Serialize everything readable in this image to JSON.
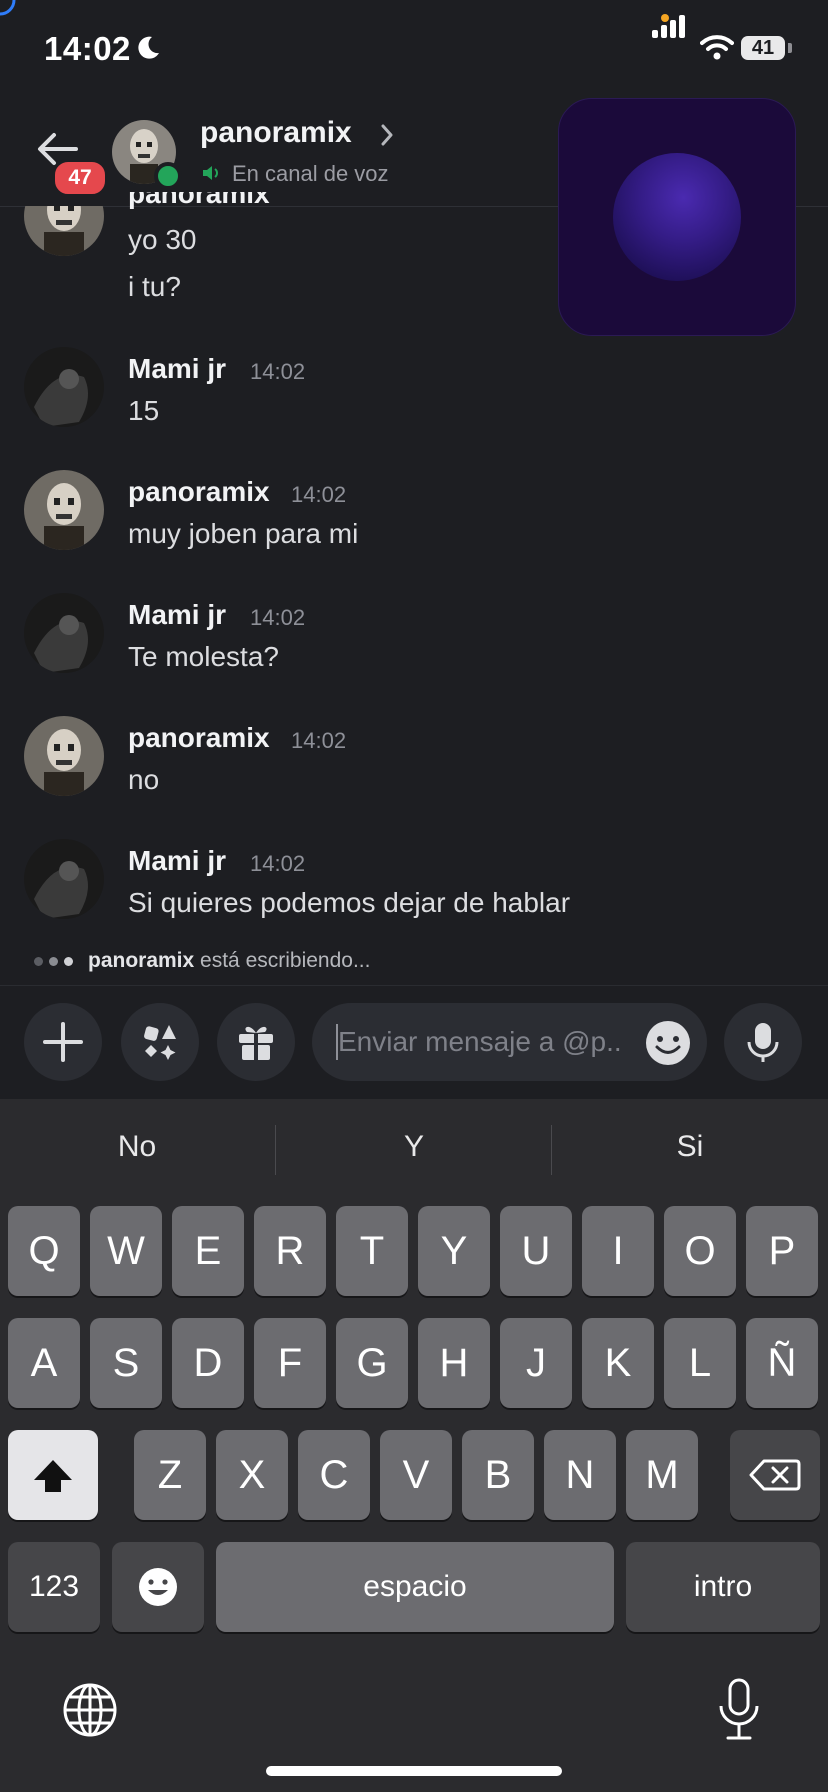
{
  "status_bar": {
    "time": "14:02",
    "battery": "41"
  },
  "header": {
    "unread_badge": "47",
    "name": "panoramix",
    "subtitle": "En canal de voz",
    "accent_online": "#23a55a"
  },
  "partial_message": {
    "name": "panoramix",
    "lines": [
      "yo 30",
      "i tu?"
    ]
  },
  "messages": [
    {
      "name": "Mami jr",
      "time": "14:02",
      "text": "15"
    },
    {
      "name": "panoramix",
      "time": "14:02",
      "text": "muy joben para mi"
    },
    {
      "name": "Mami jr",
      "time": "14:02",
      "text": "Te molesta?"
    },
    {
      "name": "panoramix",
      "time": "14:02",
      "text": "no"
    },
    {
      "name": "Mami jr",
      "time": "14:02",
      "text": "Si quieres podemos dejar de hablar"
    }
  ],
  "typing": {
    "user": "panoramix",
    "text": "está escribiendo..."
  },
  "composer": {
    "placeholder": "Enviar mensaje a @p.."
  },
  "keyboard": {
    "suggestions": [
      "No",
      "Y",
      "Si"
    ],
    "row1": [
      "Q",
      "W",
      "E",
      "R",
      "T",
      "Y",
      "U",
      "I",
      "O",
      "P"
    ],
    "row2": [
      "A",
      "S",
      "D",
      "F",
      "G",
      "H",
      "J",
      "K",
      "L",
      "Ñ"
    ],
    "row3": [
      "Z",
      "X",
      "C",
      "V",
      "B",
      "N",
      "M"
    ],
    "numbers_key": "123",
    "space_key": "espacio",
    "return_key": "intro"
  }
}
